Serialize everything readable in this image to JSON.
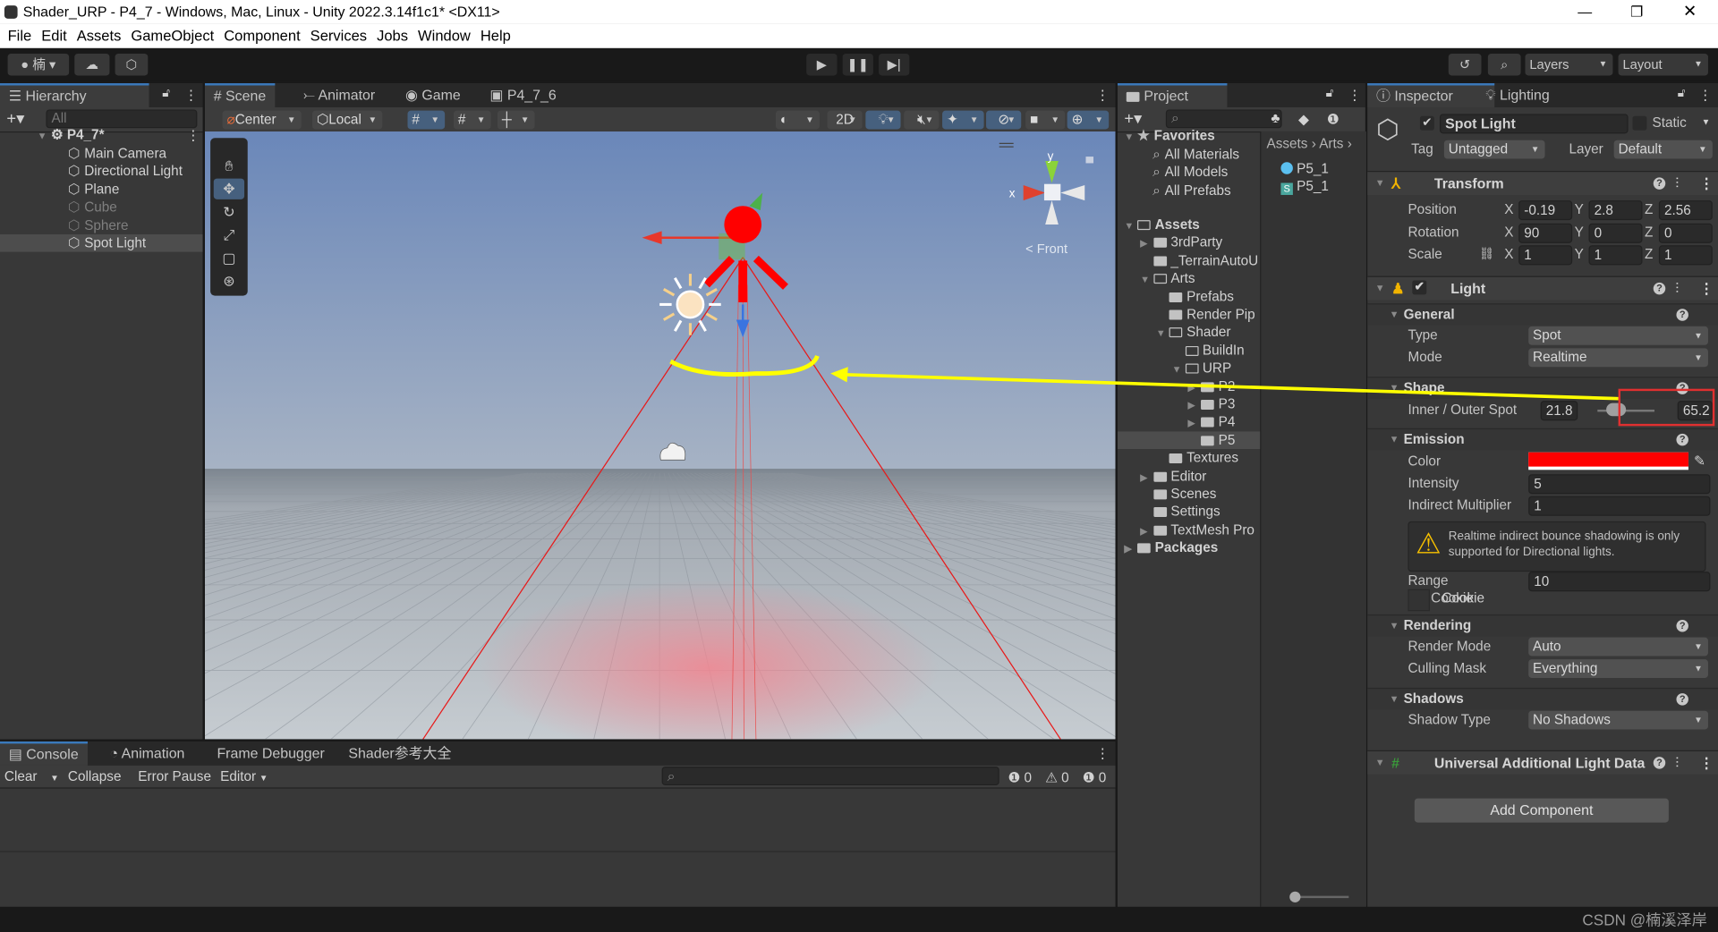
{
  "window": {
    "title": "Shader_URP - P4_7 - Windows, Mac, Linux - Unity 2022.3.14f1c1* <DX11>",
    "controls": [
      "minimize",
      "restore",
      "close"
    ]
  },
  "menu": [
    "File",
    "Edit",
    "Assets",
    "GameObject",
    "Component",
    "Services",
    "Jobs",
    "Window",
    "Help"
  ],
  "toolbar": {
    "account_label": "楠",
    "layers": "Layers",
    "layout": "Layout",
    "icons": [
      "account-icon",
      "cloud-icon",
      "collab-icon",
      "play-icon",
      "pause-icon",
      "step-icon",
      "history-icon",
      "search-icon"
    ]
  },
  "hierarchy": {
    "tab": "Hierarchy",
    "search_placeholder": "All",
    "scene": "P4_7*",
    "items": [
      {
        "label": "Main Camera",
        "active": true
      },
      {
        "label": "Directional Light",
        "active": true
      },
      {
        "label": "Plane",
        "active": true
      },
      {
        "label": "Cube",
        "active": false
      },
      {
        "label": "Sphere",
        "active": false
      },
      {
        "label": "Spot Light",
        "active": true,
        "selected": true
      }
    ]
  },
  "scene": {
    "tabs": [
      "Scene",
      "Animator",
      "Game",
      "P4_7_6"
    ],
    "active_tab": "Scene",
    "pivot": "Center",
    "space": "Local",
    "mode_2d": "2D",
    "gizmo_view": "Front",
    "gizmo_axes": [
      "y",
      "x"
    ]
  },
  "console": {
    "tabs": [
      "Console",
      "Animation",
      "Frame Debugger",
      "Shader参考大全"
    ],
    "buttons": [
      "Clear",
      "Collapse",
      "Error Pause",
      "Editor"
    ],
    "counts": {
      "info": "0",
      "warning": "0",
      "error": "0"
    }
  },
  "project": {
    "tab": "Project",
    "breadcrumb": [
      "Assets",
      "Arts"
    ],
    "files": [
      {
        "label": "P5_1",
        "type": "material"
      },
      {
        "label": "P5_1",
        "type": "shader"
      }
    ],
    "favorites": {
      "label": "Favorites",
      "items": [
        "All Materials",
        "All Models",
        "All Prefabs"
      ]
    },
    "tree": [
      {
        "label": "Assets",
        "depth": 0,
        "arrow": "down",
        "bold": true,
        "open": true
      },
      {
        "label": "3rdParty",
        "depth": 1,
        "arrow": "right"
      },
      {
        "label": "_TerrainAutoU",
        "depth": 1,
        "arrow": ""
      },
      {
        "label": "Arts",
        "depth": 1,
        "arrow": "down",
        "open": true
      },
      {
        "label": "Prefabs",
        "depth": 2,
        "arrow": ""
      },
      {
        "label": "Render Pip",
        "depth": 2,
        "arrow": ""
      },
      {
        "label": "Shader",
        "depth": 2,
        "arrow": "down",
        "open": true
      },
      {
        "label": "BuildIn",
        "depth": 3,
        "arrow": "",
        "empty": true
      },
      {
        "label": "URP",
        "depth": 3,
        "arrow": "down",
        "open": true
      },
      {
        "label": "P2",
        "depth": 4,
        "arrow": "right"
      },
      {
        "label": "P3",
        "depth": 4,
        "arrow": "right"
      },
      {
        "label": "P4",
        "depth": 4,
        "arrow": "right"
      },
      {
        "label": "P5",
        "depth": 4,
        "arrow": "",
        "selected": true
      },
      {
        "label": "Textures",
        "depth": 2,
        "arrow": ""
      },
      {
        "label": "Editor",
        "depth": 1,
        "arrow": "right"
      },
      {
        "label": "Scenes",
        "depth": 1,
        "arrow": ""
      },
      {
        "label": "Settings",
        "depth": 1,
        "arrow": ""
      },
      {
        "label": "TextMesh Pro",
        "depth": 1,
        "arrow": "right"
      },
      {
        "label": "Packages",
        "depth": 0,
        "arrow": "right",
        "bold": true
      }
    ]
  },
  "inspector": {
    "tabs": [
      "Inspector",
      "Lighting"
    ],
    "object_name": "Spot Light",
    "enabled": true,
    "static_label": "Static",
    "static": false,
    "tag_label": "Tag",
    "tag": "Untagged",
    "layer_label": "Layer",
    "layer": "Default",
    "transform": {
      "title": "Transform",
      "position": {
        "label": "Position",
        "x": "-0.19",
        "y": "2.8",
        "z": "2.56"
      },
      "rotation": {
        "label": "Rotation",
        "x": "90",
        "y": "0",
        "z": "0"
      },
      "scale": {
        "label": "Scale",
        "x": "1",
        "y": "1",
        "z": "1"
      }
    },
    "light": {
      "title": "Light",
      "enabled": true,
      "general": {
        "title": "General",
        "type_label": "Type",
        "type": "Spot",
        "mode_label": "Mode",
        "mode": "Realtime"
      },
      "shape": {
        "title": "Shape",
        "label": "Inner / Outer Spot",
        "inner": "21.8",
        "outer": "65.2"
      },
      "emission": {
        "title": "Emission",
        "color_label": "Color",
        "color": "#ff0000",
        "intensity_label": "Intensity",
        "intensity": "5",
        "indirect_label": "Indirect Multiplier",
        "indirect": "1",
        "warning": "Realtime indirect bounce shadowing is only supported for Directional lights.",
        "range_label": "Range",
        "range": "10",
        "cookie_label": "Cookie"
      },
      "rendering": {
        "title": "Rendering",
        "render_mode_label": "Render Mode",
        "render_mode": "Auto",
        "culling_label": "Culling Mask",
        "culling": "Everything"
      },
      "shadows": {
        "title": "Shadows",
        "type_label": "Shadow Type",
        "type": "No Shadows"
      }
    },
    "urp": {
      "title": "Universal Additional Light Data"
    },
    "add_component": "Add Component"
  },
  "watermark": "CSDN @楠溪泽岸",
  "colors": {
    "accent": "#3a79bb",
    "annotation": "#ffff00",
    "highlight_box": "#e03030",
    "spot_gizmo": "#ff0000"
  }
}
